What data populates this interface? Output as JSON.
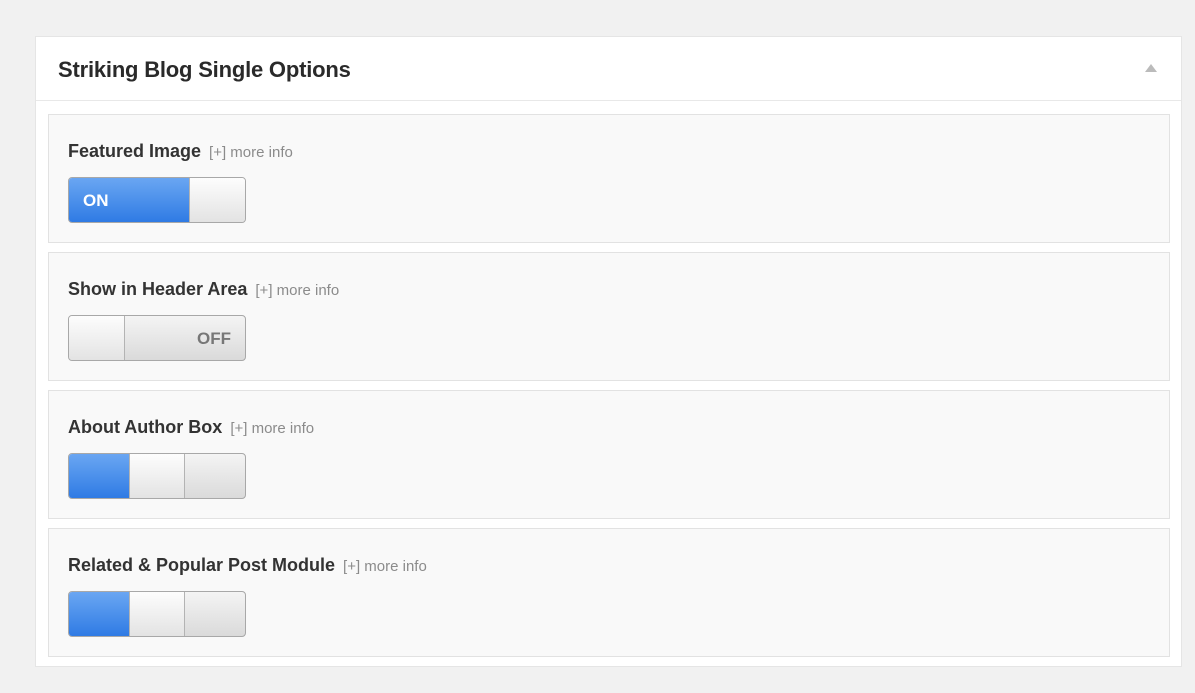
{
  "panel": {
    "title": "Striking Blog Single Options"
  },
  "options": [
    {
      "label": "Featured Image",
      "more_info": "[+] more info",
      "toggle_state": "on",
      "toggle_text": "ON"
    },
    {
      "label": "Show in Header Area",
      "more_info": "[+] more info",
      "toggle_state": "off",
      "toggle_text": "OFF"
    },
    {
      "label": "About Author Box",
      "more_info": "[+] more info",
      "toggle_state": "indeterminate",
      "toggle_text": ""
    },
    {
      "label": "Related & Popular Post Module",
      "more_info": "[+] more info",
      "toggle_state": "indeterminate",
      "toggle_text": ""
    }
  ],
  "colors": {
    "toggle_on": "#2f7be4",
    "background": "#f1f1f1",
    "panel": "#ffffff"
  },
  "icons": {
    "collapse": "triangle-up-icon"
  }
}
